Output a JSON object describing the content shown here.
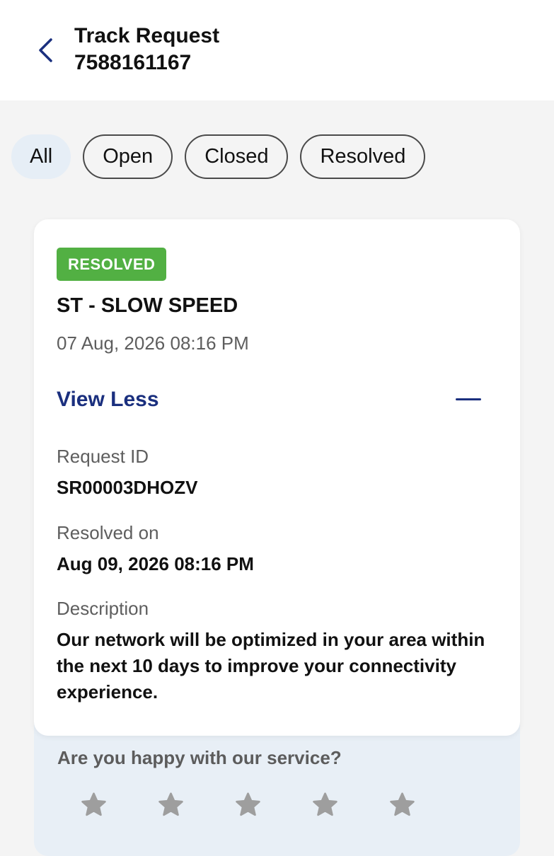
{
  "header": {
    "title": "Track Request",
    "number": "7588161167"
  },
  "filters": [
    {
      "label": "All",
      "active": true
    },
    {
      "label": "Open",
      "active": false
    },
    {
      "label": "Closed",
      "active": false
    },
    {
      "label": "Resolved",
      "active": false
    }
  ],
  "card": {
    "status": "RESOLVED",
    "title": "ST - SLOW SPEED",
    "date": "07 Aug, 2026 08:16 PM",
    "toggle_label": "View Less",
    "request_id_label": "Request ID",
    "request_id": "SR00003DHOZV",
    "resolved_on_label": "Resolved on",
    "resolved_on": "Aug 09, 2026 08:16 PM",
    "description_label": "Description",
    "description": "Our network will be optimized in your area within the next 10 days to improve your connectivity experience."
  },
  "feedback": {
    "question": "Are you happy with our service?",
    "rating": 0,
    "max_rating": 5
  },
  "colors": {
    "accent": "#1a2f7e",
    "resolved_badge": "#52b043",
    "feedback_bg": "#e8eff6",
    "star_inactive": "#9e9e9e"
  }
}
